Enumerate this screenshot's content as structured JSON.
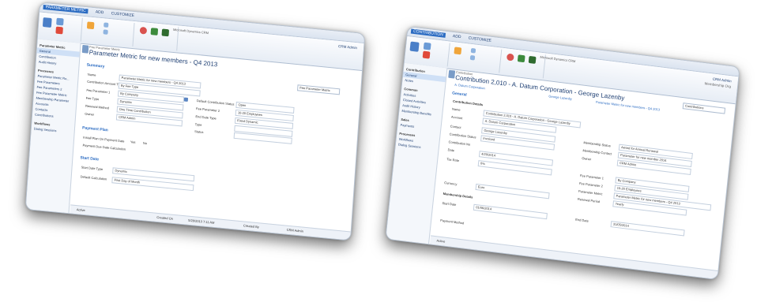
{
  "left": {
    "ribbon_tabs": [
      "PARAMETER METRIC",
      "ADD",
      "CUSTOMIZE"
    ],
    "crm_title": "Microsoft Dynamics CRM",
    "user_name": "CRM Admin",
    "nav_items": [
      "Parameter Metric",
      "General",
      "Contribution",
      "Audit History",
      "Processes",
      "Parameter Metric Ro...",
      "Fee Parameters",
      "Fee Parameters 2",
      "Fee Parameter Metric",
      "Membership Parameter",
      "Accounts",
      "Contacts",
      "Contributions",
      "Workflows",
      "Dialog Sessions"
    ],
    "form_sub": "Fee Parameter Metric",
    "form_title": "Parameter Metric for new members - Q4 2013",
    "form_selector": "Fee Parameter Metric",
    "sec_summary": "Summary",
    "name_label": "Name",
    "name_value": "Parameter Metric for new members - Q4 2013",
    "contrib_type_label": "Contribution Amount Type",
    "contrib_type_value": "By Fee Type",
    "fee_param1_label": "Fee Parameter 1",
    "fee_param1_value": "By Company",
    "default_contrib_label": "Default Contribution Status",
    "default_contrib_value": "Open",
    "fee_type_label": "Fee Type",
    "fee_type_value": "Dynamic",
    "fee_param2_label": "Fee Parameter 2",
    "fee_param2_value": "10-20 Employees",
    "renewal_label": "Renewal Method",
    "renewal_value": "One Time Contribution",
    "end_date_type_label": "End Date Type",
    "end_date_type_value": "Fixed Dynamic",
    "owner_label": "Owner",
    "owner_value": "CRM Admin",
    "type_label": "Type",
    "status_label": "Status",
    "sec_payment": "Payment Plan",
    "install_label": "Install Plan On Payment Date",
    "payment_due_label": "Payment Due Date Calculation",
    "yes": "Yes",
    "no": "No",
    "sec_start": "Start Date",
    "start_type_label": "Start Date Type",
    "start_type_value": "Dynamic",
    "default_cal_label": "Default Calculation",
    "default_cal_value": "First Day of Month",
    "footer_status": "Active",
    "footer_created": "Created On",
    "footer_date": "5/28/2013 7:11 AM",
    "footer_created_by": "Created By",
    "footer_user": "CRM Admin"
  },
  "right": {
    "ribbon_tabs": [
      "CONTRIBUTION",
      "ADD",
      "CUSTOMIZE"
    ],
    "crm_title": "Microsoft Dynamics CRM",
    "user_name": "CRM Admin",
    "user_org": "Membership Org",
    "nav_items": [
      "Contribution",
      "General",
      "Notes",
      "Common",
      "Activities",
      "Closed Activities",
      "Audit History",
      "Membership Benefits",
      "Sales",
      "Payments",
      "Processes",
      "Workflows",
      "Dialog Sessions"
    ],
    "form_sub": "Contribution",
    "form_title": "Contribution 2,010 - A. Datum Corporation - George Lazenby",
    "header_org": "A. Datum Corporation",
    "header_contact": "George Lazenby",
    "header_metric": "Parameter Metric for new members - Q4 2013",
    "form_selector": "Contributions",
    "sec_general": "General",
    "contrib_details": "Contribution Details",
    "name_label": "Name",
    "name_value": "Contribution 2,010 - A. Datum Corporation - George Lazenby",
    "account_label": "Account",
    "account_value": "A. Datum Corporation",
    "contact_label": "Contact",
    "contact_value": "George Lazenby",
    "status_label": "Contribution Status",
    "status_value": "Invoiced",
    "contrib_no_label": "Contribution No",
    "date_label": "Date",
    "date_value": "4/20/2014",
    "renewal_label": "Membership Status",
    "renewal_value": "Award for Annual Renewal",
    "member_contact_label": "Membership Contact",
    "member_contact_value": "Parameter for new member 2014",
    "owner_label": "Owner",
    "owner_value": "CRM Admin",
    "tax_label": "Tax Rate",
    "tax_value": "0%",
    "fee_param1_label": "Fee Parameter 1",
    "fee_param1_value": "By Company",
    "fee_param2_label": "Fee Parameter 2",
    "fee_param2_value": "10-20 Employees",
    "metric_label": "Parameter Metric",
    "metric_value": "Parameter Metric for new members - Q4 2013",
    "period_label": "Renewal Period",
    "period_value": "Yearly",
    "currency_label": "Currency",
    "currency_value": "Euro",
    "sec_membership": "Membership Details",
    "start_label": "Start Date",
    "start_value": "01/06/2014",
    "end_label": "End Date",
    "end_value": "31/05/2014",
    "footer_status": "Active",
    "pay_label": "Payment Method"
  }
}
